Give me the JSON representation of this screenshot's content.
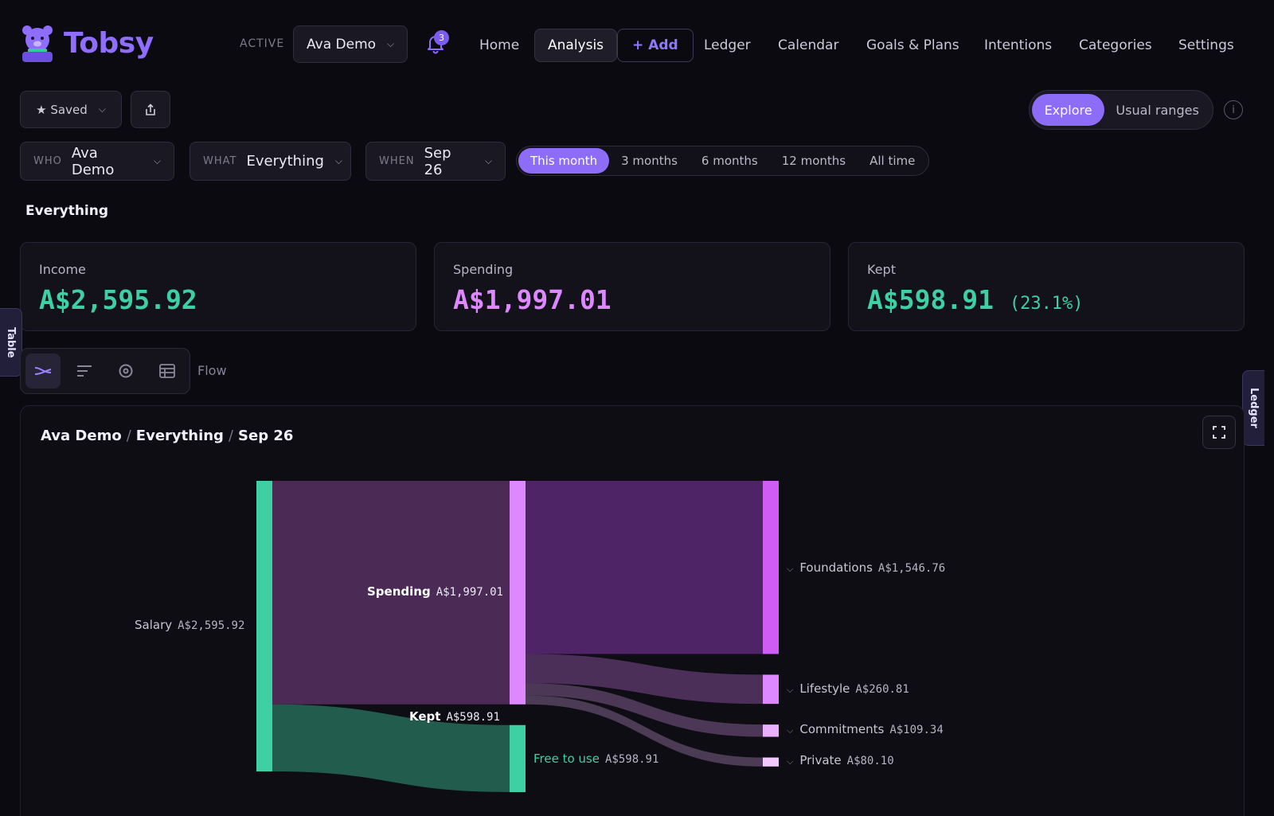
{
  "app": {
    "name": "Tobsy"
  },
  "header": {
    "active_label": "ACTIVE",
    "active_profile": "Ava Demo",
    "notification_count": "3",
    "nav": {
      "home": "Home",
      "analysis": "Analysis",
      "add": "+ Add",
      "ledger": "Ledger",
      "calendar": "Calendar",
      "goals": "Goals & Plans",
      "intentions": "Intentions",
      "categories": "Categories",
      "settings": "Settings"
    }
  },
  "toolbar": {
    "saved_label": "★ Saved",
    "mode": {
      "explore": "Explore",
      "usual": "Usual ranges",
      "selected": "Explore"
    }
  },
  "filters": {
    "who_label": "WHO",
    "who_value": "Ava Demo",
    "what_label": "WHAT",
    "what_value": "Everything",
    "when_label": "WHEN",
    "when_value": "Sep 26",
    "ranges": [
      "This month",
      "3 months",
      "6 months",
      "12 months",
      "All time"
    ],
    "range_selected": "This month"
  },
  "section_title": "Everything",
  "summary": {
    "income": {
      "label": "Income",
      "value": "A$2,595.92"
    },
    "spending": {
      "label": "Spending",
      "value": "A$1,997.01"
    },
    "kept": {
      "label": "Kept",
      "value": "A$598.91",
      "pct": "(23.1%)"
    }
  },
  "side_tabs": {
    "table": "Table",
    "ledger": "Ledger"
  },
  "view": {
    "label": "Flow",
    "icons": [
      "flow-icon",
      "bars-icon",
      "donut-icon",
      "table-icon"
    ]
  },
  "breadcrumb": {
    "who": "Ava Demo",
    "what": "Everything",
    "when": "Sep 26"
  },
  "colors": {
    "income": "#3ecfa3",
    "spending": "#dd88ff",
    "accent": "#8d6cf8",
    "foundations": "#cf5cf5"
  },
  "chart_data": {
    "type": "sankey",
    "nodes": [
      {
        "name": "Salary",
        "value": 2595.92,
        "label": "A$2,595.92"
      },
      {
        "name": "Spending",
        "value": 1997.01,
        "label": "A$1,997.01"
      },
      {
        "name": "Kept",
        "value": 598.91,
        "label": "A$598.91"
      },
      {
        "name": "Free to use",
        "value": 598.91,
        "label": "A$598.91"
      },
      {
        "name": "Foundations",
        "value": 1546.76,
        "label": "A$1,546.76"
      },
      {
        "name": "Lifestyle",
        "value": 260.81,
        "label": "A$260.81"
      },
      {
        "name": "Commitments",
        "value": 109.34,
        "label": "A$109.34"
      },
      {
        "name": "Private",
        "value": 80.1,
        "label": "A$80.10"
      }
    ],
    "links": [
      {
        "source": "Salary",
        "target": "Spending",
        "value": 1997.01
      },
      {
        "source": "Salary",
        "target": "Kept",
        "value": 598.91
      },
      {
        "source": "Kept",
        "target": "Free to use",
        "value": 598.91
      },
      {
        "source": "Spending",
        "target": "Foundations",
        "value": 1546.76
      },
      {
        "source": "Spending",
        "target": "Lifestyle",
        "value": 260.81
      },
      {
        "source": "Spending",
        "target": "Commitments",
        "value": 109.34
      },
      {
        "source": "Spending",
        "target": "Private",
        "value": 80.1
      }
    ]
  }
}
